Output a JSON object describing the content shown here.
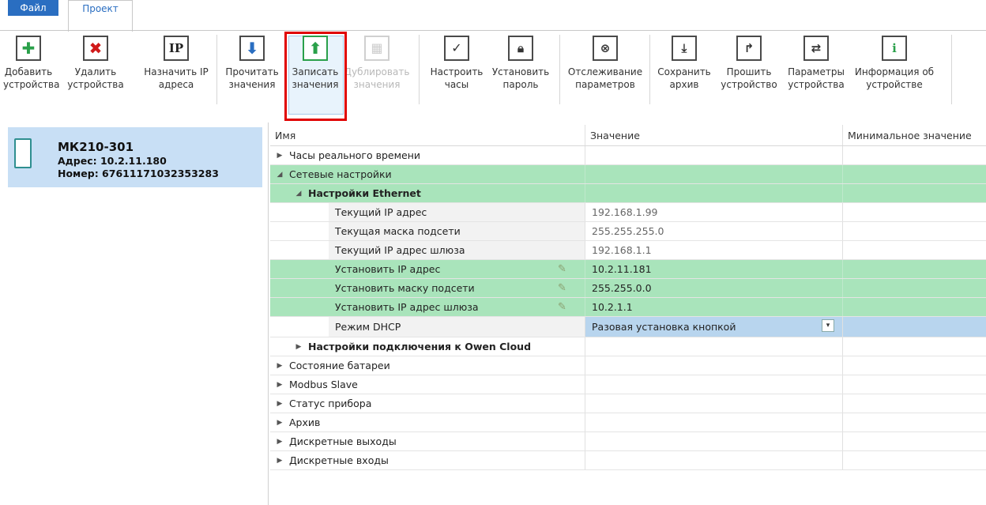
{
  "tabs": {
    "file": "Файл",
    "project": "Проект"
  },
  "toolbar": {
    "add_device": "Добавить\nустройства",
    "remove_device": "Удалить\nустройства",
    "assign_ip": "Назначить IP\nадреса",
    "assign_ip_glyph": "IP",
    "read_values": "Прочитать\nзначения",
    "write_values": "Записать\nзначения",
    "duplicate_values": "Дублировать\nзначения",
    "set_clock": "Настроить\nчасы",
    "set_password": "Установить\nпароль",
    "monitor_params": "Отслеживание\nпараметров",
    "save_archive": "Сохранить\nархив",
    "flash_device": "Прошить\nустройство",
    "device_params": "Параметры\nустройства",
    "device_info": "Информация об\nустройстве"
  },
  "device": {
    "name": "МК210-301",
    "address": "Адрес: 10.2.11.180",
    "number": "Номер: 67611171032353283"
  },
  "grid": {
    "columns": {
      "name": "Имя",
      "value": "Значение",
      "min": "Минимальное значение"
    },
    "rows": [
      {
        "label": "Часы реального времени",
        "value": ""
      },
      {
        "label": "Сетевые настройки",
        "value": ""
      },
      {
        "label": "Настройки Ethernet",
        "value": ""
      },
      {
        "label": "Текущий IP адрес",
        "value": "192.168.1.99"
      },
      {
        "label": "Текущая маска подсети",
        "value": "255.255.255.0"
      },
      {
        "label": "Текущий IP адрес шлюза",
        "value": "192.168.1.1"
      },
      {
        "label": "Установить IP адрес",
        "value": "10.2.11.181"
      },
      {
        "label": "Установить маску подсети",
        "value": "255.255.0.0"
      },
      {
        "label": "Установить IP адрес шлюза",
        "value": "10.2.1.1"
      },
      {
        "label": "Режим DHCP",
        "value": "Разовая установка кнопкой"
      },
      {
        "label": "Настройки подключения к Owen Cloud",
        "value": ""
      },
      {
        "label": "Состояние батареи",
        "value": ""
      },
      {
        "label": "Modbus Slave",
        "value": ""
      },
      {
        "label": "Статус прибора",
        "value": ""
      },
      {
        "label": "Архив",
        "value": ""
      },
      {
        "label": "Дискретные выходы",
        "value": ""
      },
      {
        "label": "Дискретные входы",
        "value": ""
      }
    ]
  },
  "colors": {
    "accent": "#2a6ec1",
    "row_green": "#a9e4bb",
    "selection": "#c8dff5",
    "highlight_box": "#e00000"
  }
}
